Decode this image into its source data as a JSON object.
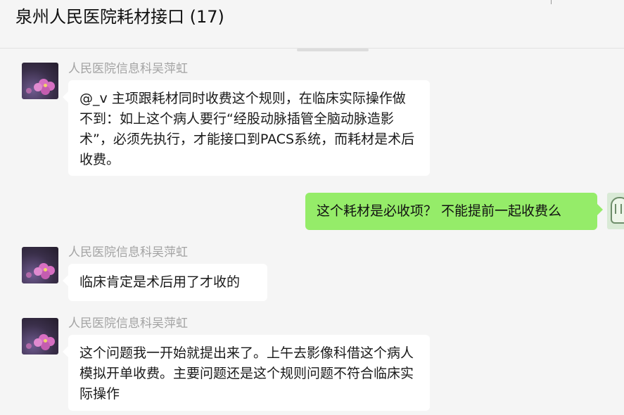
{
  "chat": {
    "title": "泉州人民医院耗材接口 (17)"
  },
  "messages": [
    {
      "sender": "人民医院信息科吴萍虹",
      "text": "@_v 主项跟耗材同时收费这个规则，在临床实际操作做不到：如上这个病人要行“经股动脉插管全脑动脉造影术”，必须先执行，才能接口到PACS系统，而耗材是术后收费。",
      "avatar_icon": "flower-avatar-icon"
    },
    {
      "sender": "",
      "text": "这个耗材是必收项？ 不能提前一起收费么",
      "avatar_icon": "user-avatar-icon",
      "is_self": true
    },
    {
      "sender": "人民医院信息科吴萍虹",
      "text": "临床肯定是术后用了才收的",
      "avatar_icon": "flower-avatar-icon"
    },
    {
      "sender": "人民医院信息科吴萍虹",
      "text": "这个问题我一开始就提出来了。上午去影像科借这个病人模拟开单收费。主要问题还是这个规则问题不符合临床实际操作",
      "avatar_icon": "flower-avatar-icon"
    }
  ],
  "colors": {
    "self_bubble": "#95ec69",
    "other_bubble": "#ffffff",
    "background": "#f5f5f5"
  }
}
